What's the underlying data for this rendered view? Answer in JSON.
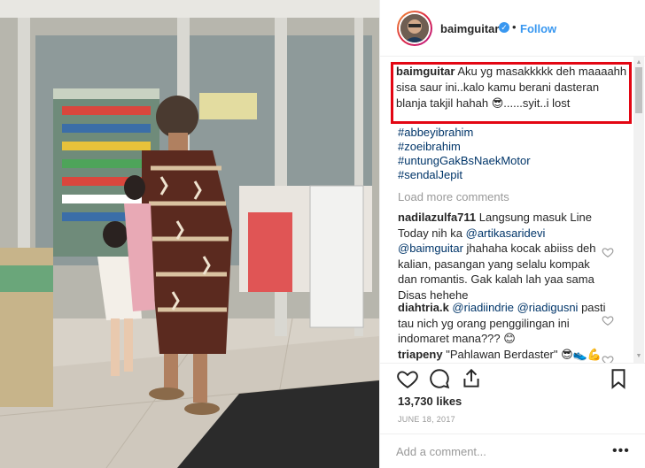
{
  "photo": {
    "alt_name": "post-photo"
  },
  "header": {
    "username": "baimguitar",
    "verified_icon": "verified-check-icon",
    "separator": "•",
    "follow_label": "Follow"
  },
  "caption": {
    "username": "baimguitar",
    "text": "Aku yg masakkkkk deh maaaahh sisa saur ini..kalo kamu berani dasteran blanja takjil hahah 😎......syit..i lost"
  },
  "hashtags": [
    "#abbeyibrahim",
    "#zoeibrahim",
    "#untungGakBsNaekMotor",
    "#sendalJepit"
  ],
  "load_more": "Load more comments",
  "comments": [
    {
      "username": "nadilazulfa711",
      "text": "Langsung masuk Line Today nih ka",
      "mention1": "@artikasaridevi",
      "mention2": "@baimguitar",
      "text2": "jhahaha kocak abiiss deh kalian, pasangan yang selalu kompak dan romantis. Gak kalah lah yaa sama Disas hehehe"
    },
    {
      "username": "diahtria.k",
      "mention1": "@riadiindrie",
      "mention2": "@riadigusni",
      "text": "pasti tau nich yg orang penggilingan ini indomaret mana??? 😊"
    },
    {
      "username": "triapeny",
      "text": "\"Pahlawan Berdaster\" 😎👟💪"
    }
  ],
  "actions": {
    "like_icon": "heart-outline-icon",
    "comment_icon": "comment-bubble-icon",
    "share_icon": "share-upload-icon",
    "save_icon": "bookmark-icon"
  },
  "likes": "13,730 likes",
  "date": "JUNE 18, 2017",
  "add_comment": {
    "placeholder": "Add a comment...",
    "more": "•••"
  },
  "colors": {
    "link": "#003569",
    "follow": "#3897f0",
    "highlight": "#e30613",
    "muted": "#999999"
  }
}
